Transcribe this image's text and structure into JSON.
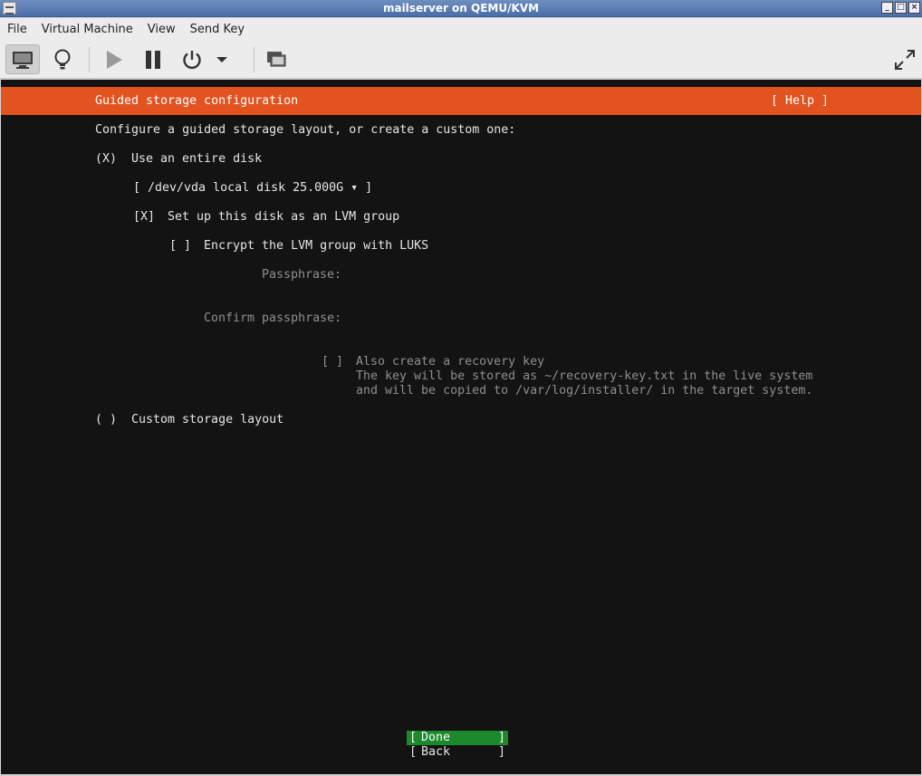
{
  "window": {
    "title": "mailserver on QEMU/KVM",
    "buttons": [
      "_",
      "□",
      "×"
    ]
  },
  "menubar": {
    "items": [
      "File",
      "Virtual Machine",
      "View",
      "Send Key"
    ]
  },
  "toolbar": {
    "buttons": [
      "display-icon",
      "bulb-icon",
      "play-icon",
      "pause-icon",
      "power-icon",
      "dropdown-arrow-icon",
      "screens-icon",
      "fullscreen-icon"
    ]
  },
  "installer": {
    "header_title": "Guided storage configuration",
    "help_label": "[ Help ]",
    "intro": "Configure a guided storage layout, or create a custom one:",
    "entire_disk": {
      "marker": "(X)",
      "label": "Use an entire disk"
    },
    "disk_select": "[ /dev/vda local disk 25.000G ▾ ]",
    "lvm": {
      "marker": "[X]",
      "label": "Set up this disk as an LVM group"
    },
    "luks": {
      "marker": "[ ]",
      "label": "Encrypt the LVM group with LUKS"
    },
    "passphrase_label": "Passphrase:",
    "confirm_label": "Confirm passphrase:",
    "recovery": {
      "marker": "[ ]",
      "label": "Also create a recovery key",
      "note1": "The key will be stored as ~/recovery-key.txt in the live system",
      "note2": "and will be copied to /var/log/installer/ in the target system."
    },
    "custom": {
      "marker": "( )",
      "label": "Custom storage layout"
    },
    "done_label": "Done",
    "back_label": "Back"
  },
  "colors": {
    "header_orange": "#e2531f",
    "done_green": "#1c8a2c",
    "console_bg": "#131313"
  }
}
